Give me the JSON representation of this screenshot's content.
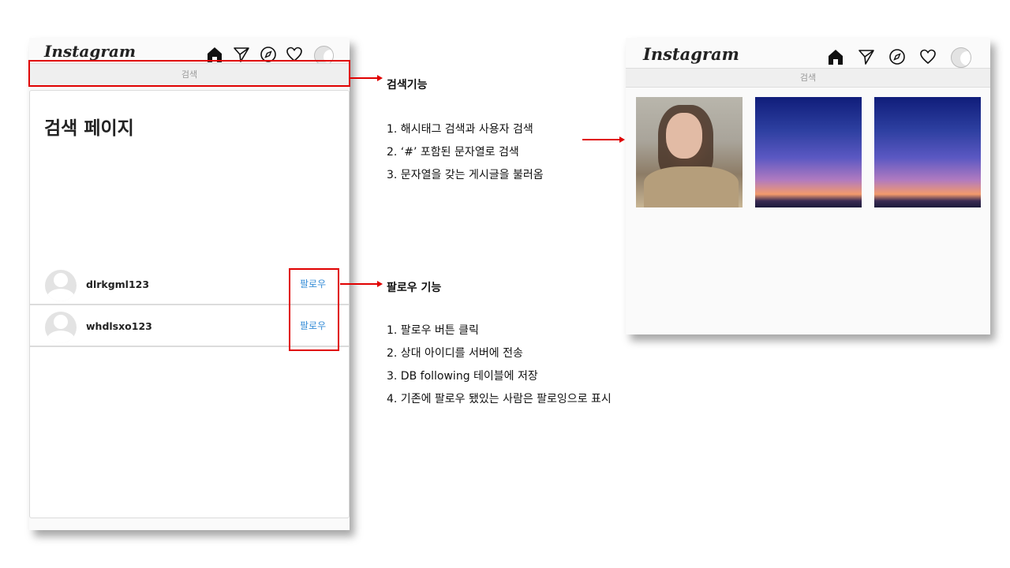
{
  "app": {
    "logo_text": "Instagram"
  },
  "nav_icons": [
    "home-icon",
    "send-icon",
    "compass-icon",
    "heart-icon",
    "profile-icon"
  ],
  "search": {
    "placeholder": "검색"
  },
  "search_page": {
    "title": "검색 페이지",
    "users": [
      {
        "username": "dlrkgml123",
        "follow_label": "팔로우"
      },
      {
        "username": "whdlsxo123",
        "follow_label": "팔로우"
      }
    ]
  },
  "notes": {
    "search": {
      "title": "검색기능",
      "items": [
        "1.  해시태그 검색과 사용자 검색",
        "2.  ‘#’ 포함된 문자열로 검색",
        "3.  문자열을 갖는 게시글을 불러옴"
      ]
    },
    "follow": {
      "title": "팔로우 기능",
      "items": [
        "1.  팔로우 버튼 클릭",
        "2.  상대 아이디를 서버에 전송",
        "3.  DB following 테이블에 저장",
        "4.  기존에 팔로우 됐있는 사람은 팔로잉으로 표시"
      ]
    }
  },
  "feed": {
    "posts": [
      "portrait-photo",
      "sunset-photo",
      "sunset-photo"
    ]
  },
  "colors": {
    "annotation": "#e00000",
    "follow": "#3a8fd8"
  }
}
